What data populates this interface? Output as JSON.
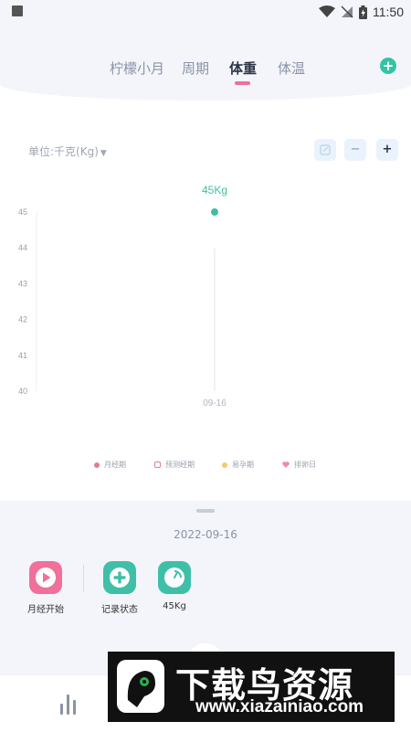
{
  "status_bar": {
    "time": "11:50"
  },
  "tabs": [
    {
      "label": "柠檬小月",
      "active": false
    },
    {
      "label": "周期",
      "active": false
    },
    {
      "label": "体重",
      "active": true
    },
    {
      "label": "体温",
      "active": false
    }
  ],
  "unit_selector": {
    "label": "单位:千克(Kg)"
  },
  "chart_data": {
    "type": "scatter",
    "categories": [
      "09-16"
    ],
    "values": [
      45
    ],
    "data_labels": [
      "45Kg"
    ],
    "y_ticks": [
      "45",
      "44",
      "43",
      "42",
      "41",
      "40"
    ],
    "ylim": [
      40,
      45
    ],
    "color": "#3fbfa8"
  },
  "legend": [
    {
      "label": "月经期",
      "color": "#e57b8f",
      "shape": "dot"
    },
    {
      "label": "预测经期",
      "color": "#e57b8f",
      "shape": "ring"
    },
    {
      "label": "易孕期",
      "color": "#f5c96a",
      "shape": "dot"
    },
    {
      "label": "排卵日",
      "color": "#f08aa8",
      "shape": "heart"
    }
  ],
  "sheet": {
    "date": "2022-09-16",
    "actions": [
      {
        "label": "月经开始",
        "icon": "play-icon",
        "color": "#f0709a"
      },
      {
        "label": "记录状态",
        "icon": "plus-icon",
        "color": "#3fbfa8"
      },
      {
        "label": "45Kg",
        "icon": "scale-icon",
        "color": "#3fbfa8"
      }
    ]
  },
  "watermark": {
    "title": "下载鸟资源",
    "url": "www.xiazainiao.com"
  }
}
